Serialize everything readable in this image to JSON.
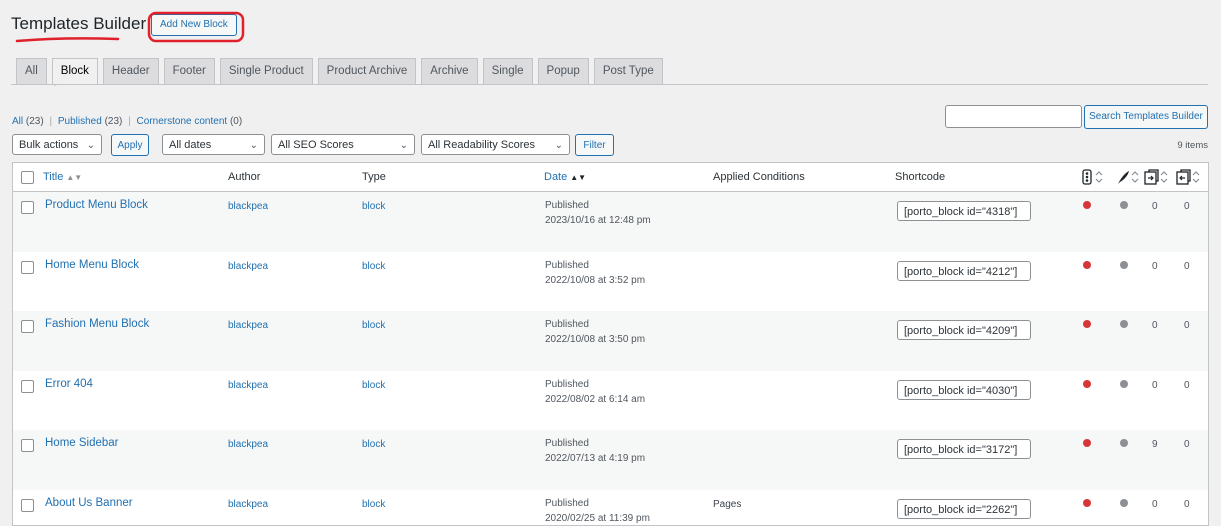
{
  "page": {
    "title": "Templates Builder",
    "add_new_label": "Add New Block"
  },
  "tabs": [
    "All",
    "Block",
    "Header",
    "Footer",
    "Single Product",
    "Product Archive",
    "Archive",
    "Single",
    "Popup",
    "Post Type"
  ],
  "active_tab": "Block",
  "filters_links": [
    {
      "label": "All",
      "count": "(23)"
    },
    {
      "label": "Published",
      "count": "(23)"
    },
    {
      "label": "Cornerstone content",
      "count": "(0)"
    }
  ],
  "search": {
    "value": "",
    "button_label": "Search Templates Builder"
  },
  "bulk": {
    "bulk_actions": "Bulk actions",
    "apply": "Apply",
    "dates": "All dates",
    "seo": "All SEO Scores",
    "readability": "All Readability Scores",
    "filter": "Filter"
  },
  "items_count": "9 items",
  "table": {
    "headers": {
      "title": "Title",
      "author": "Author",
      "type": "Type",
      "date": "Date",
      "applied": "Applied Conditions",
      "shortcode": "Shortcode"
    },
    "rows": [
      {
        "title": "Product Menu Block",
        "author": "blackpea",
        "type": "block",
        "status": "Published",
        "date": "2023/10/16 at 12:48 pm",
        "applied": "",
        "shortcode": "[porto_block id=\"4318\"]",
        "seo": "red",
        "readability": "gray",
        "links_out": "0",
        "links_in": "0"
      },
      {
        "title": "Home Menu Block",
        "author": "blackpea",
        "type": "block",
        "status": "Published",
        "date": "2022/10/08 at 3:52 pm",
        "applied": "",
        "shortcode": "[porto_block id=\"4212\"]",
        "seo": "red",
        "readability": "gray",
        "links_out": "0",
        "links_in": "0"
      },
      {
        "title": "Fashion Menu Block",
        "author": "blackpea",
        "type": "block",
        "status": "Published",
        "date": "2022/10/08 at 3:50 pm",
        "applied": "",
        "shortcode": "[porto_block id=\"4209\"]",
        "seo": "red",
        "readability": "gray",
        "links_out": "0",
        "links_in": "0"
      },
      {
        "title": "Error 404",
        "author": "blackpea",
        "type": "block",
        "status": "Published",
        "date": "2022/08/02 at 6:14 am",
        "applied": "",
        "shortcode": "[porto_block id=\"4030\"]",
        "seo": "red",
        "readability": "gray",
        "links_out": "0",
        "links_in": "0"
      },
      {
        "title": "Home Sidebar",
        "author": "blackpea",
        "type": "block",
        "status": "Published",
        "date": "2022/07/13 at 4:19 pm",
        "applied": "",
        "shortcode": "[porto_block id=\"3172\"]",
        "seo": "red",
        "readability": "gray",
        "links_out": "9",
        "links_in": "0"
      },
      {
        "title": "About Us Banner",
        "author": "blackpea",
        "type": "block",
        "status": "Published",
        "date": "2020/02/25 at 11:39 pm",
        "applied": "Pages",
        "shortcode": "[porto_block id=\"2262\"]",
        "seo": "red",
        "readability": "gray",
        "links_out": "0",
        "links_in": "0"
      }
    ]
  },
  "colors": {
    "seo_red": "#d63638",
    "readability_gray": "#8c8f94",
    "annotation_red": "#e0202a",
    "link": "#2271b1"
  }
}
